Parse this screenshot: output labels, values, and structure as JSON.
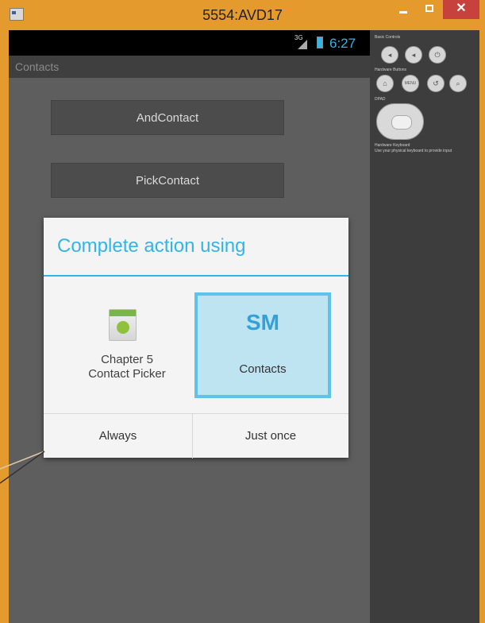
{
  "window": {
    "title": "5554:AVD17",
    "close_label": "✕"
  },
  "status": {
    "network": "3G",
    "time": "6:27"
  },
  "app": {
    "title": "Contacts",
    "buttons": [
      "AndContact",
      "PickContact"
    ]
  },
  "dialog": {
    "title": "Complete action using",
    "options": [
      {
        "line1": "Chapter 5",
        "line2": "Contact Picker",
        "icon": "android-app-icon",
        "icon_text": "Android"
      },
      {
        "badge": "SM",
        "label": "Contacts",
        "selected": true
      }
    ],
    "buttons": {
      "always": "Always",
      "once": "Just once"
    }
  },
  "panel": {
    "basic_label": "Basic Controls",
    "hardware_label": "Hardware Buttons",
    "menu_label": "MENU",
    "dpad_label": "DPAD",
    "keyboard_label": "Hardware Keyboard",
    "keyboard_hint": "Use your physical keyboard to provide input"
  },
  "colors": {
    "accent": "#33b5e5",
    "titlebar": "#e59a2e",
    "close": "#c7413d"
  }
}
